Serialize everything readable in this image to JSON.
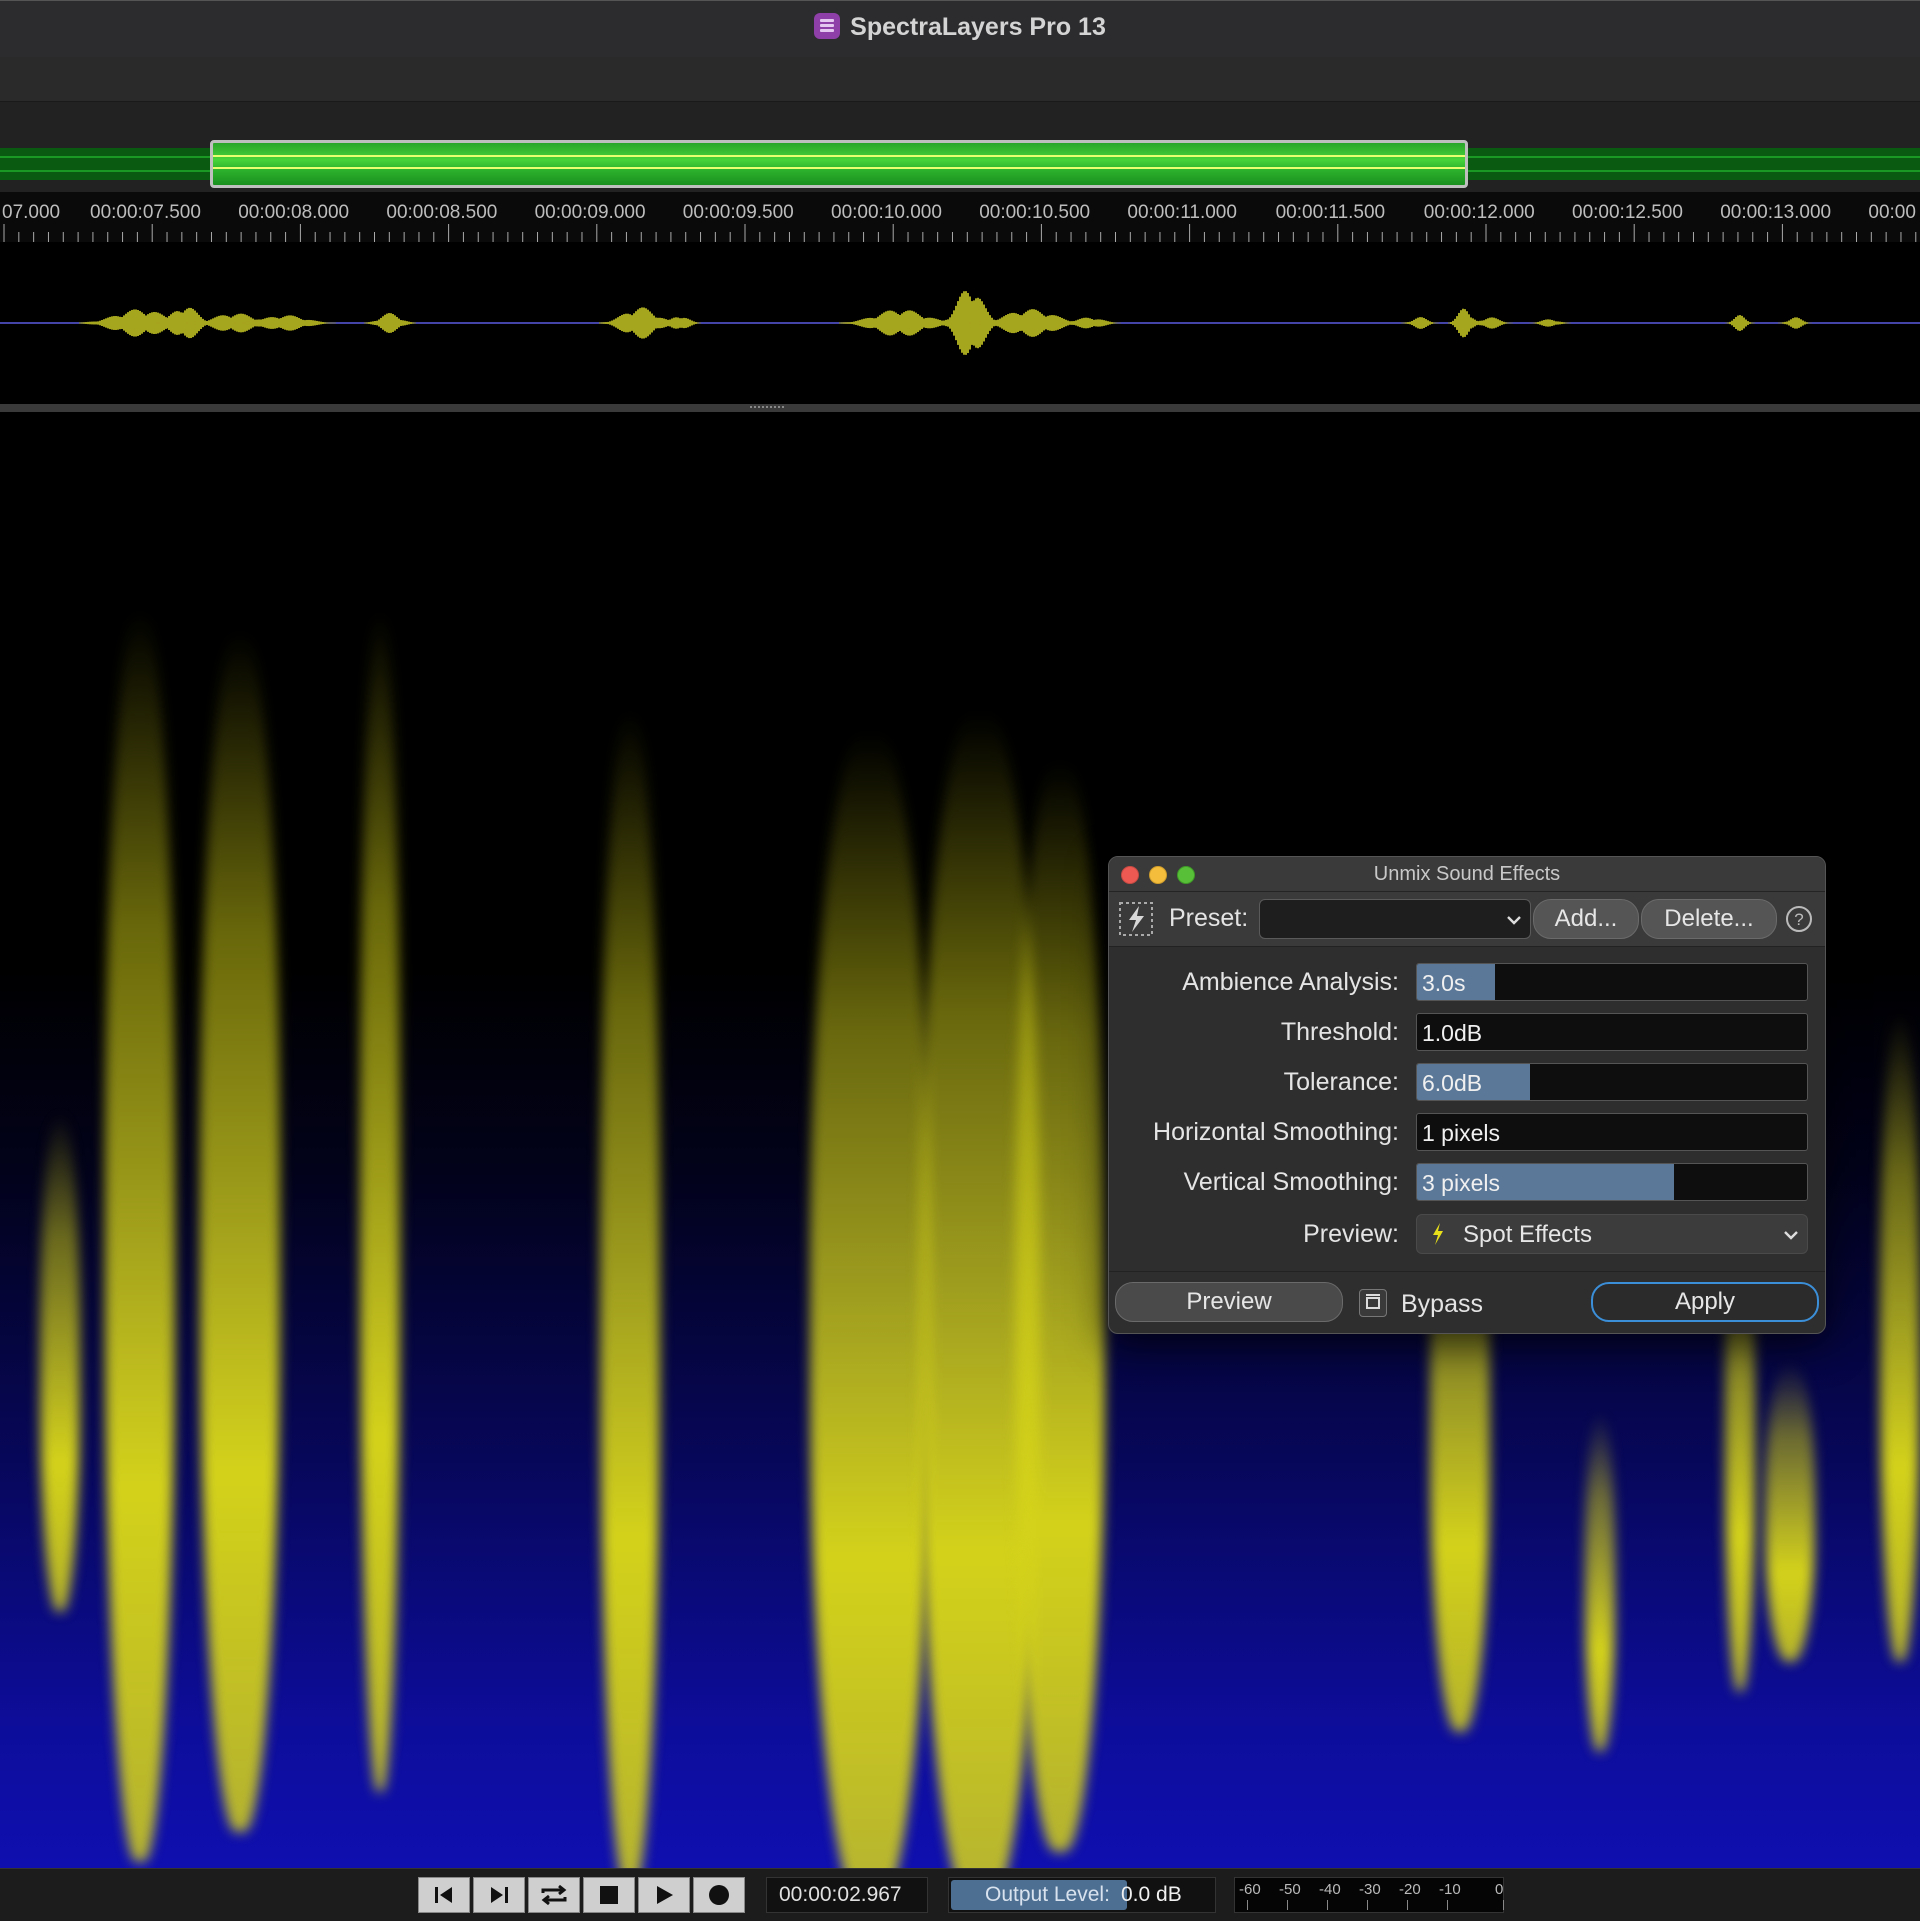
{
  "window": {
    "title": "SpectraLayers Pro 13"
  },
  "colors": {
    "waveform": "#a6a51e",
    "selection": "#2fb62e",
    "spectrogram_hot": "#d4d21a",
    "spectrogram_cold": "#0f0fb0",
    "apply_border": "#3b8fd9"
  },
  "ruler": {
    "labels": [
      "07.000",
      "00:00:07.500",
      "00:00:08.000",
      "00:00:08.500",
      "00:00:09.000",
      "00:00:09.500",
      "00:00:10.000",
      "00:00:10.500",
      "00:00:11.000",
      "00:00:11.500",
      "00:00:12.000",
      "00:00:12.500",
      "00:00:13.000",
      "00:00"
    ]
  },
  "dialog": {
    "title": "Unmix Sound Effects",
    "preset_label": "Preset:",
    "preset_value": "",
    "add_label": "Add...",
    "delete_label": "Delete...",
    "help_icon": "question-circle-icon",
    "params": [
      {
        "label": "Ambience Analysis:",
        "value": "3.0s",
        "fill": 0.2
      },
      {
        "label": "Threshold:",
        "value": "1.0dB",
        "fill": 0.0
      },
      {
        "label": "Tolerance:",
        "value": "6.0dB",
        "fill": 0.29
      },
      {
        "label": "Horizontal Smoothing:",
        "value": "1 pixels",
        "fill": 0.0
      },
      {
        "label": "Vertical Smoothing:",
        "value": "3 pixels",
        "fill": 0.66
      }
    ],
    "preview_label": "Preview:",
    "preview_value": "Spot Effects",
    "preview_button": "Preview",
    "bypass_label": "Bypass",
    "apply_button": "Apply"
  },
  "transport": {
    "time": "00:00:02.967",
    "output_level_label": "Output Level:",
    "output_level_value": "0.0 dB",
    "meter_labels": [
      "-60",
      "-50",
      "-40",
      "-30",
      "-20",
      "-10",
      "0"
    ]
  }
}
